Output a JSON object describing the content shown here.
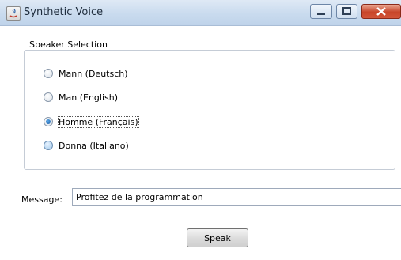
{
  "window": {
    "title": "Synthetic Voice"
  },
  "speaker_selection": {
    "title": "Speaker Selection",
    "options": [
      {
        "label": "Mann (Deutsch)",
        "selected": false
      },
      {
        "label": "Man (English)",
        "selected": false
      },
      {
        "label": "Homme (Français)",
        "selected": true
      },
      {
        "label": "Donna (Italiano)",
        "selected": false
      }
    ]
  },
  "message": {
    "label": "Message:",
    "value": "Profitez de la programmation"
  },
  "speak_button": {
    "label": "Speak"
  },
  "icons": {
    "app": "java-app-icon",
    "minimize": "minimize-icon",
    "maximize": "maximize-icon",
    "close": "close-icon"
  }
}
